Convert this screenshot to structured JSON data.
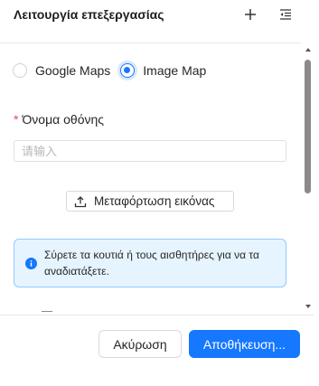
{
  "header": {
    "title": "Λειτουργία επεξεργασίας",
    "add_icon": "plus-icon",
    "menu_icon": "indent-menu-icon"
  },
  "map_type": {
    "options": [
      {
        "label": "Google Maps",
        "selected": false
      },
      {
        "label": "Image Map",
        "selected": true
      }
    ]
  },
  "screen_name": {
    "required_mark": "*",
    "label": "Όνομα οθόνης",
    "value": "",
    "placeholder": "请输入"
  },
  "upload": {
    "icon": "upload-icon",
    "label": "Μεταφόρτωση εικόνας"
  },
  "info": {
    "icon": "info-icon",
    "text": "Σύρετε τα κουτιά ή τους αισθητήρες για να τα αναδιατάξετε."
  },
  "footer": {
    "cancel_label": "Ακύρωση",
    "save_label": "Αποθήκευση..."
  },
  "colors": {
    "primary": "#1677ff",
    "info_bg": "#e6f4ff",
    "info_border": "#91caff",
    "required": "#e5484d"
  }
}
